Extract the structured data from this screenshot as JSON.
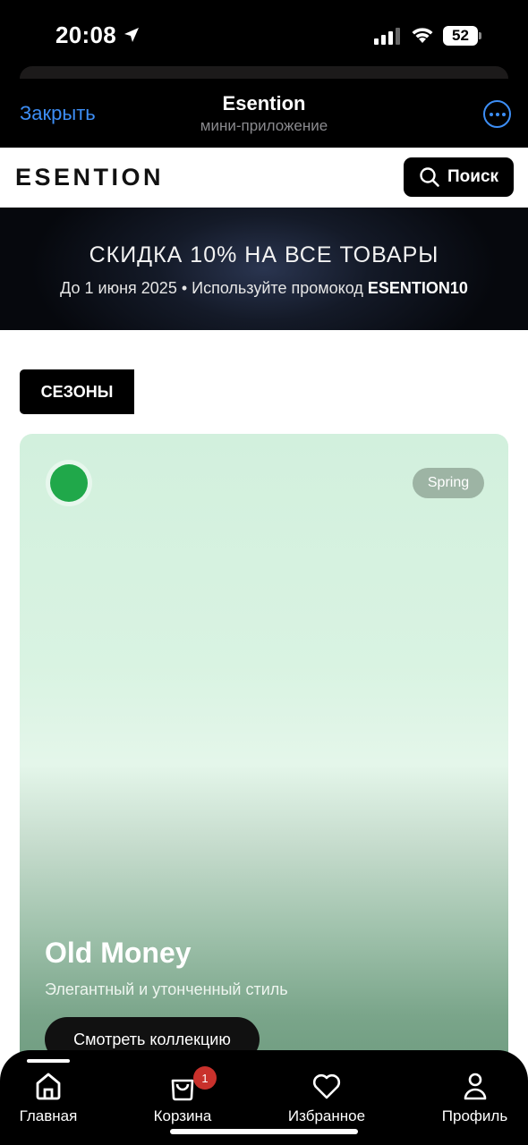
{
  "status_bar": {
    "time": "20:08",
    "battery": "52",
    "icons": [
      "location-arrow-icon",
      "cellular-signal-icon",
      "wifi-icon",
      "battery-icon"
    ]
  },
  "app_header": {
    "close_label": "Закрыть",
    "title": "Esention",
    "subtitle": "мини-приложение",
    "more_icon": "ellipsis-circle-icon",
    "accent_color": "#3d8ef5"
  },
  "site_header": {
    "logo": "ESENTION",
    "search_label": "Поиск",
    "search_icon": "search-icon"
  },
  "promo": {
    "title": "СКИДКА 10% НА ВСЕ ТОВАРЫ",
    "subtitle_prefix": "До 1 июня 2025 • Используйте промокод ",
    "code": "ESENTION10"
  },
  "section": {
    "tag": "СЕЗОНЫ"
  },
  "season_card": {
    "badge": "Spring",
    "title": "Old Money",
    "subtitle": "Элегантный и утонченный стиль",
    "button_label": "Смотреть коллекцию",
    "dot_color": "#20a84a"
  },
  "bottom_nav": {
    "items": [
      {
        "label": "Главная",
        "icon": "home-icon",
        "active": true
      },
      {
        "label": "Корзина",
        "icon": "shopping-bag-icon",
        "badge": "1"
      },
      {
        "label": "Избранное",
        "icon": "heart-icon"
      },
      {
        "label": "Профиль",
        "icon": "user-icon"
      }
    ],
    "badge_color": "#c9312c"
  }
}
